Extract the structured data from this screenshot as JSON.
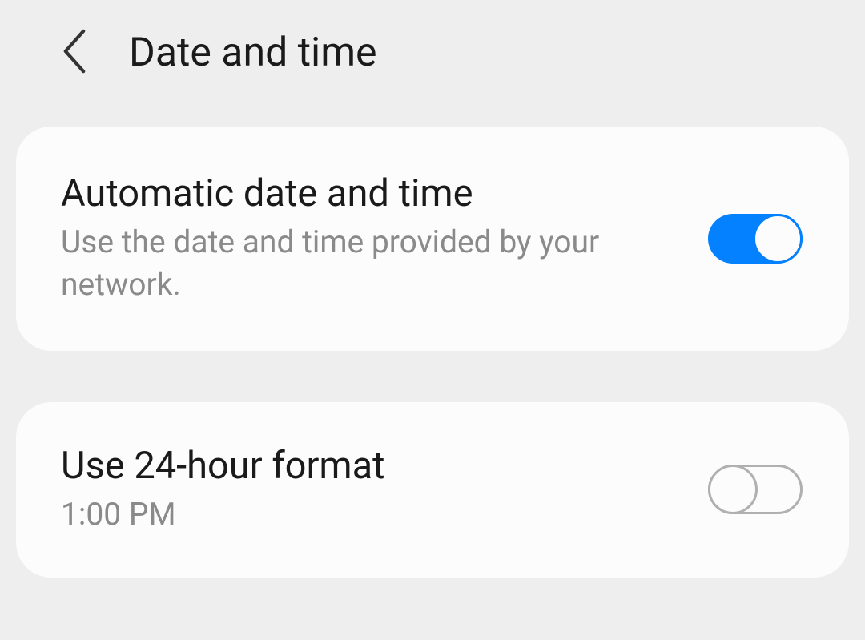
{
  "header": {
    "title": "Date and time"
  },
  "settings": {
    "automatic": {
      "title": "Automatic date and time",
      "subtitle": "Use the date and time provided by your network.",
      "enabled": true
    },
    "format24h": {
      "title": "Use 24-hour format",
      "subtitle": "1:00 PM",
      "enabled": false
    }
  }
}
